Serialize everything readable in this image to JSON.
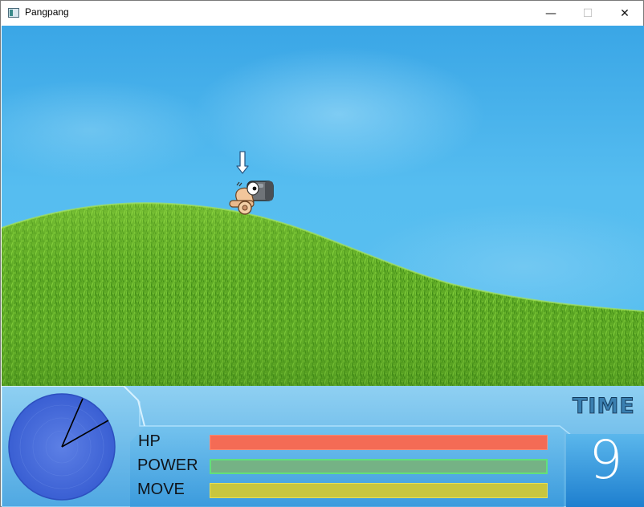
{
  "window": {
    "title": "Pangpang",
    "controls": {
      "minimize": "—",
      "maximize": "☐",
      "close": "✕"
    }
  },
  "game": {
    "player": {
      "indicator_icon": "down-arrow-icon",
      "sprite": "cannon-character"
    }
  },
  "hud": {
    "labels": {
      "hp": "HP",
      "power": "POWER",
      "move": "MOVE"
    },
    "bars": {
      "hp": {
        "value": 1.0,
        "color": "#f46b55"
      },
      "power": {
        "value": 0.0,
        "color": "#75b285"
      },
      "move": {
        "value": 1.0,
        "color": "#c9c63e"
      }
    },
    "time": {
      "label": "TIME",
      "value": "9"
    },
    "angle_dial": {
      "lines": 2,
      "color": "#3a66d6"
    }
  }
}
